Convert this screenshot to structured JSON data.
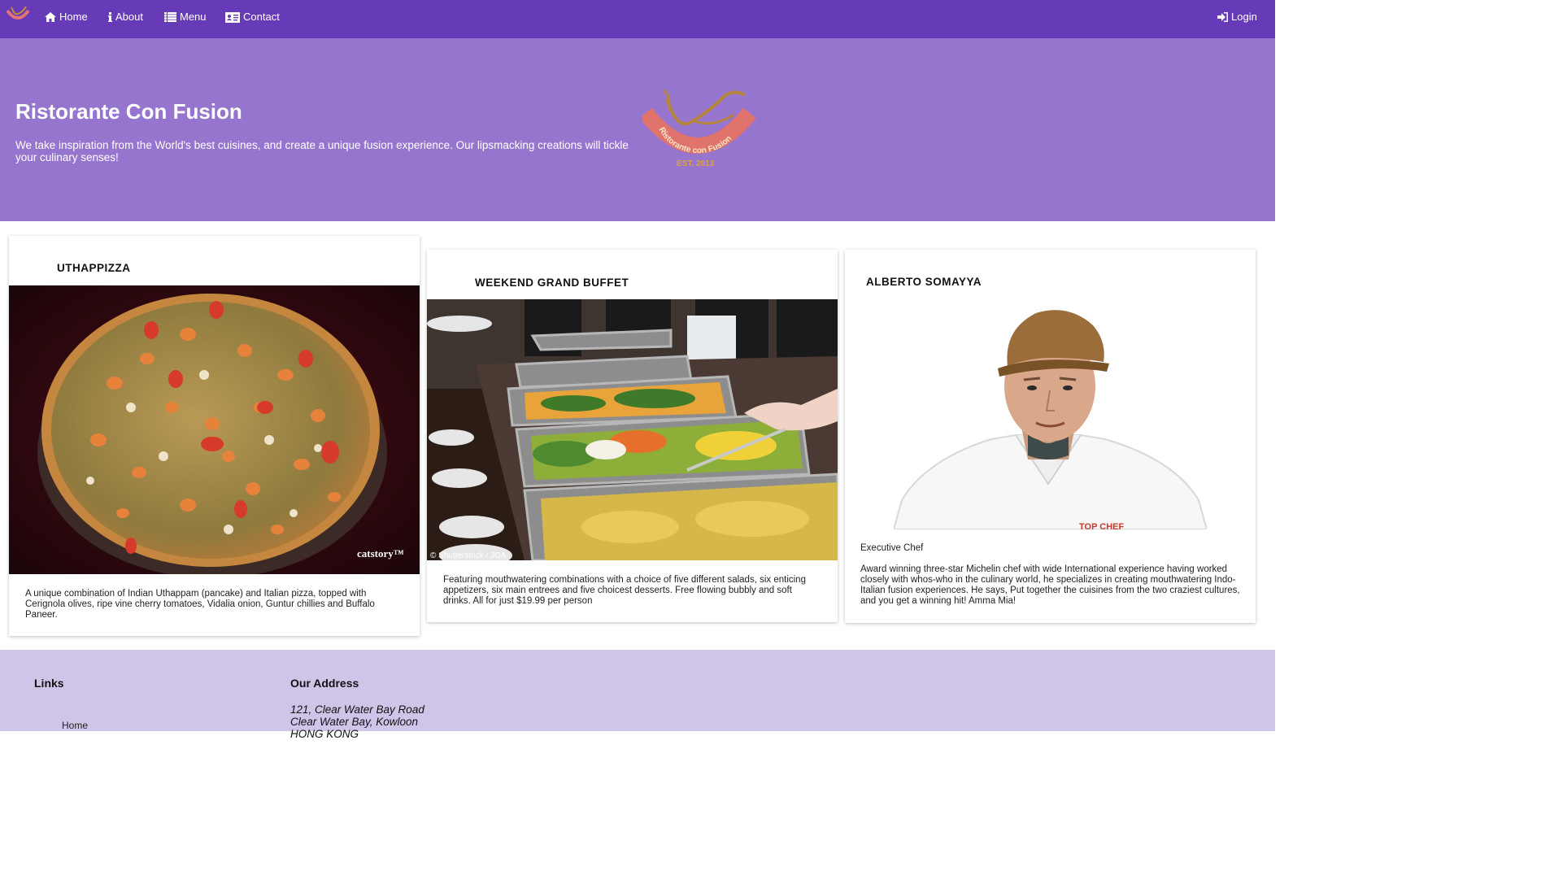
{
  "navbar": {
    "brand_icon": "restaurant-logo-icon",
    "items": [
      {
        "label": "Home",
        "icon": "home-icon"
      },
      {
        "label": "About",
        "icon": "info-icon"
      },
      {
        "label": "Menu",
        "icon": "list-icon"
      },
      {
        "label": "Contact",
        "icon": "address-card-icon"
      }
    ],
    "login": {
      "label": "Login",
      "icon": "sign-in-icon"
    }
  },
  "jumbotron": {
    "title": "Ristorante Con Fusion",
    "text": "We take inspiration from the World's best cuisines, and create a unique fusion experience. Our lipsmacking creations will tickle your culinary senses!",
    "logo_text": "Ristorante con Fusion",
    "logo_est": "EST. 2013"
  },
  "cards": [
    {
      "title": "UTHAPPIZZA",
      "image_caption": "catstory™",
      "text": "A unique combination of Indian Uthappam (pancake) and Italian pizza, topped with Cerignola olives, ripe vine cherry tomatoes, Vidalia onion, Guntur chillies and Buffalo Paneer."
    },
    {
      "title": "WEEKEND GRAND BUFFET",
      "image_caption": "© Shutterstock / JGA",
      "text": "Featuring mouthwatering combinations with a choice of five different salads, six enticing appetizers, six main entrees and five choicest desserts. Free flowing bubbly and soft drinks. All for just $19.99 per person"
    },
    {
      "title": "ALBERTO SOMAYYA",
      "image_caption": "TOP CHEF",
      "subtitle": "Executive Chef",
      "text": "Award winning three-star Michelin chef with wide International experience having worked closely with whos-who in the culinary world, he specializes in creating mouthwatering Indo-Italian fusion experiences. He says, Put together the cuisines from the two craziest cultures, and you get a winning hit! Amma Mia!"
    }
  ],
  "footer": {
    "links_heading": "Links",
    "links": [
      "Home"
    ],
    "address_heading": "Our Address",
    "address_lines": [
      "121, Clear Water Bay Road",
      "Clear Water Bay, Kowloon",
      "HONG KONG"
    ]
  },
  "colors": {
    "navbar": "#673ab7",
    "jumbotron": "#9575cd",
    "footer": "#d1c4e9"
  }
}
